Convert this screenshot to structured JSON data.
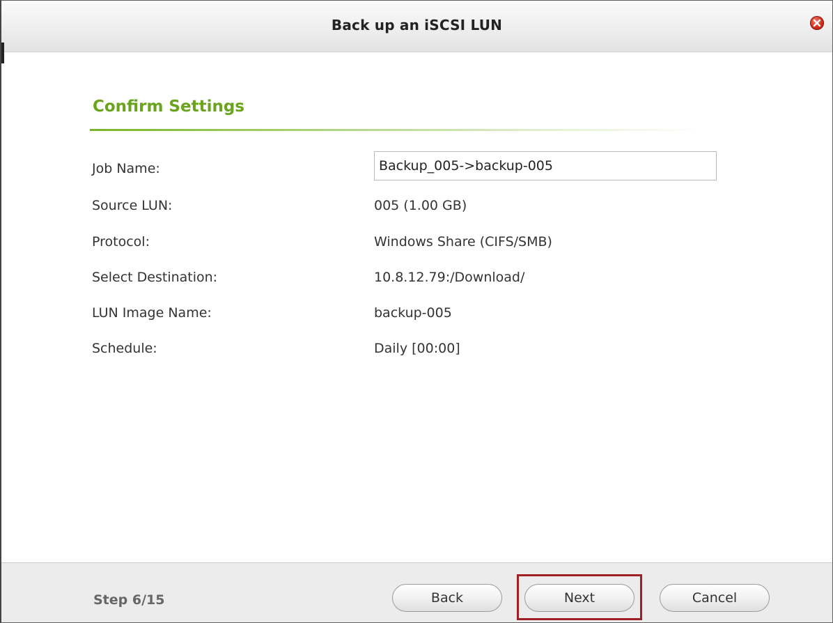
{
  "window": {
    "title": "Back up an iSCSI LUN",
    "close_icon": "close-icon"
  },
  "section": {
    "title": "Confirm Settings",
    "accent_color": "#6aa31c"
  },
  "fields": {
    "job_name": {
      "label": "Job Name:",
      "value": "Backup_005->backup-005"
    },
    "source_lun": {
      "label": "Source LUN:",
      "value": "005 (1.00 GB)"
    },
    "protocol": {
      "label": "Protocol:",
      "value": "Windows Share (CIFS/SMB)"
    },
    "destination": {
      "label": "Select Destination:",
      "value": "10.8.12.79:/Download/"
    },
    "image_name": {
      "label": "LUN Image Name:",
      "value": "backup-005"
    },
    "schedule": {
      "label": "Schedule:",
      "value": "Daily [00:00]"
    }
  },
  "footer": {
    "step": "Step 6/15",
    "back_label": "Back",
    "next_label": "Next",
    "cancel_label": "Cancel",
    "highlight_color": "#a01f24"
  }
}
